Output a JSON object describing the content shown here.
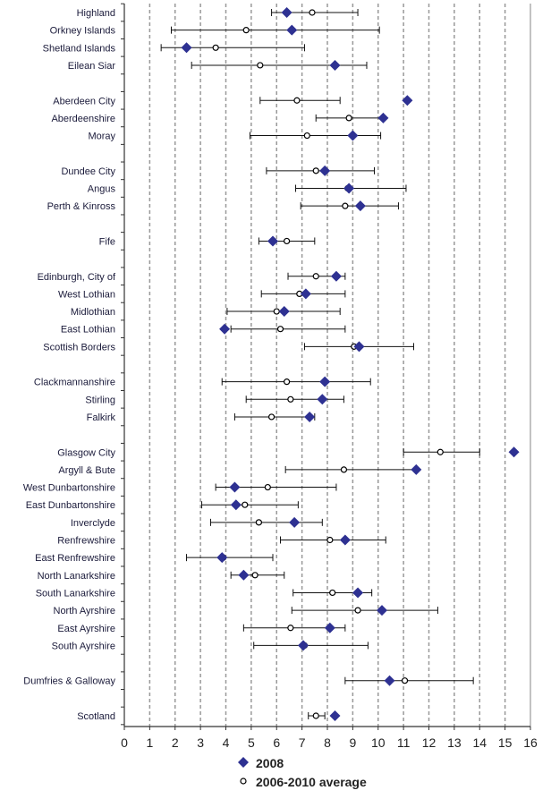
{
  "chart_data": {
    "type": "scatter",
    "subtype": "dot plot with confidence intervals",
    "xlim": [
      0,
      16
    ],
    "x_ticks": [
      0,
      1,
      2,
      3,
      4,
      5,
      6,
      7,
      8,
      9,
      10,
      11,
      12,
      13,
      14,
      15,
      16
    ],
    "grid": "vertical dashed",
    "legend_position": "bottom",
    "legend": [
      {
        "label": "2008",
        "marker": "diamond",
        "color": "#2e3192"
      },
      {
        "label": "2006-2010 average",
        "marker": "open-circle",
        "color": "#000000"
      }
    ],
    "groups": [
      [
        {
          "name": "Highland",
          "v2008": 6.4,
          "avg": 7.4,
          "low": 5.8,
          "high": 9.2
        },
        {
          "name": "Orkney Islands",
          "v2008": 6.6,
          "avg": 4.8,
          "low": 1.85,
          "high": 10.05
        },
        {
          "name": "Shetland Islands",
          "v2008": 2.45,
          "avg": 3.6,
          "low": 1.45,
          "high": 7.1
        },
        {
          "name": "Eilean Siar",
          "v2008": 8.3,
          "avg": 5.35,
          "low": 2.65,
          "high": 9.55
        }
      ],
      [
        {
          "name": "Aberdeen City",
          "v2008": 11.15,
          "avg": 6.8,
          "low": 5.35,
          "high": 8.5
        },
        {
          "name": "Aberdeenshire",
          "v2008": 10.2,
          "avg": 8.85,
          "low": 7.55,
          "high": 10.2
        },
        {
          "name": "Moray",
          "v2008": 9.0,
          "avg": 7.2,
          "low": 4.95,
          "high": 10.1
        }
      ],
      [
        {
          "name": "Dundee City",
          "v2008": 7.9,
          "avg": 7.55,
          "low": 5.6,
          "high": 9.85
        },
        {
          "name": "Angus",
          "v2008": 8.85,
          "avg": 8.8,
          "low": 6.75,
          "high": 11.1
        },
        {
          "name": "Perth & Kinross",
          "v2008": 9.3,
          "avg": 8.7,
          "low": 6.95,
          "high": 10.8
        }
      ],
      [
        {
          "name": "Fife",
          "v2008": 5.85,
          "avg": 6.4,
          "low": 5.3,
          "high": 7.5
        }
      ],
      [
        {
          "name": "Edinburgh, City of",
          "v2008": 8.35,
          "avg": 7.55,
          "low": 6.45,
          "high": 8.7
        },
        {
          "name": "West Lothian",
          "v2008": 7.15,
          "avg": 6.9,
          "low": 5.4,
          "high": 8.7
        },
        {
          "name": "Midlothian",
          "v2008": 6.3,
          "avg": 6.0,
          "low": 4.05,
          "high": 8.5
        },
        {
          "name": "East Lothian",
          "v2008": 3.95,
          "avg": 6.15,
          "low": 4.2,
          "high": 8.7
        },
        {
          "name": "Scottish Borders",
          "v2008": 9.25,
          "avg": 9.05,
          "low": 7.1,
          "high": 11.4
        }
      ],
      [
        {
          "name": "Clackmannanshire",
          "v2008": 7.9,
          "avg": 6.4,
          "low": 3.85,
          "high": 9.7
        },
        {
          "name": "Stirling",
          "v2008": 7.8,
          "avg": 6.55,
          "low": 4.8,
          "high": 8.65
        },
        {
          "name": "Falkirk",
          "v2008": 7.3,
          "avg": 5.8,
          "low": 4.35,
          "high": 7.5
        }
      ],
      [
        {
          "name": "Glasgow City",
          "v2008": 15.35,
          "avg": 12.45,
          "low": 11.0,
          "high": 14.0
        },
        {
          "name": "Argyll & Bute",
          "v2008": 11.5,
          "avg": 8.65,
          "low": 6.35,
          "high": 11.5
        },
        {
          "name": "West Dunbartonshire",
          "v2008": 4.35,
          "avg": 5.65,
          "low": 3.6,
          "high": 8.35
        },
        {
          "name": "East Dunbartonshire",
          "v2008": 4.4,
          "avg": 4.75,
          "low": 3.05,
          "high": 6.85
        },
        {
          "name": "Inverclyde",
          "v2008": 6.7,
          "avg": 5.3,
          "low": 3.4,
          "high": 7.8
        },
        {
          "name": "Renfrewshire",
          "v2008": 8.7,
          "avg": 8.1,
          "low": 6.15,
          "high": 10.3
        },
        {
          "name": "East Renfrewshire",
          "v2008": 3.85,
          "avg": 3.9,
          "low": 2.45,
          "high": 5.85
        },
        {
          "name": "North Lanarkshire",
          "v2008": 4.7,
          "avg": 5.15,
          "low": 4.2,
          "high": 6.3
        },
        {
          "name": "South Lanarkshire",
          "v2008": 9.2,
          "avg": 8.2,
          "low": 6.65,
          "high": 9.75
        },
        {
          "name": "North Ayrshire",
          "v2008": 10.15,
          "avg": 9.2,
          "low": 6.6,
          "high": 12.35
        },
        {
          "name": "East Ayrshire",
          "v2008": 8.1,
          "avg": 6.55,
          "low": 4.7,
          "high": 8.7
        },
        {
          "name": "South Ayrshire",
          "v2008": 7.05,
          "avg": 7.1,
          "low": 5.1,
          "high": 9.6
        }
      ],
      [
        {
          "name": "Dumfries & Galloway",
          "v2008": 10.45,
          "avg": 11.05,
          "low": 8.7,
          "high": 13.75
        }
      ],
      [
        {
          "name": "Scotland",
          "v2008": 8.3,
          "avg": 7.55,
          "low": 7.25,
          "high": 7.9
        }
      ]
    ]
  }
}
